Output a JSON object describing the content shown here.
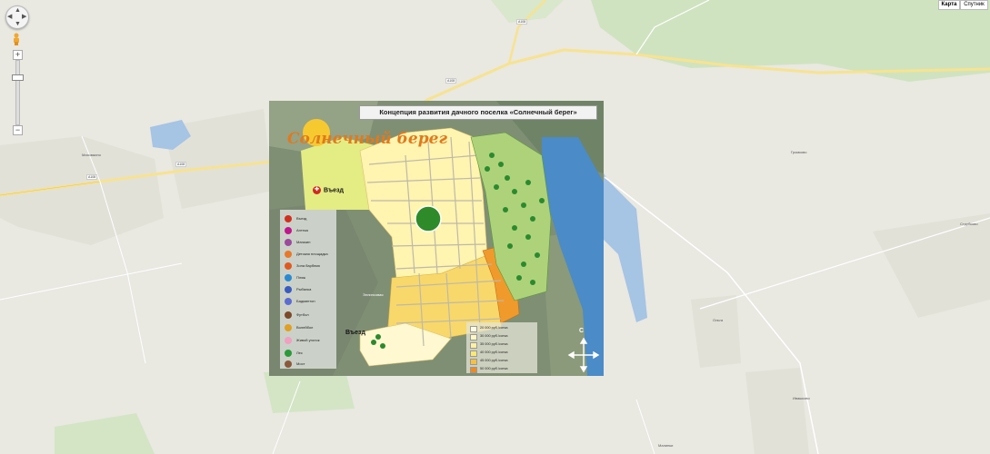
{
  "map_controls": {
    "pan_arrows": [
      "▲",
      "▼",
      "◀",
      "▶"
    ],
    "zoom_in": "+",
    "zoom_out": "−",
    "map_type_buttons": [
      {
        "label": "Карта",
        "active": true
      },
      {
        "label": "Спутник",
        "active": false
      }
    ]
  },
  "base_map": {
    "towns": [
      "Махомкино",
      "Ольга",
      "Струбково",
      "Малинки",
      "Ивашково",
      "Громково"
    ],
    "roads": [
      "А108",
      "А108",
      "А108",
      "А108"
    ]
  },
  "overlay": {
    "title": "Концепция развития дачного поселка «Солнечный берег»",
    "logo": "Солнечный берег",
    "entrances": [
      {
        "label": "Въезд"
      },
      {
        "label": "Въезд"
      }
    ],
    "street_label": "Эллипсовая",
    "compass_north": "С",
    "legend": [
      {
        "label": "Въезд",
        "icon": "entry-icon",
        "color": "#d0301e"
      },
      {
        "label": "Аптека",
        "icon": "pharmacy-icon",
        "color": "#c0188c"
      },
      {
        "label": "Магазин",
        "icon": "shop-icon",
        "color": "#9c4a9c"
      },
      {
        "label": "Детская площадка",
        "icon": "playground-icon",
        "color": "#e8782a"
      },
      {
        "label": "Зона барбекю",
        "icon": "barbecue-icon",
        "color": "#e05a20"
      },
      {
        "label": "Пляж",
        "icon": "beach-icon",
        "color": "#2a8ad0"
      },
      {
        "label": "Рыбалка",
        "icon": "fishing-icon",
        "color": "#3a5cc0"
      },
      {
        "label": "Бадминтон",
        "icon": "badminton-icon",
        "color": "#5a6cd0"
      },
      {
        "label": "Футбол",
        "icon": "football-icon",
        "color": "#7a4a2a"
      },
      {
        "label": "Волейбол",
        "icon": "volleyball-icon",
        "color": "#e0a020"
      },
      {
        "label": "Живой уголок",
        "icon": "petting-zoo-icon",
        "color": "#f0a0c0"
      },
      {
        "label": "Лес",
        "icon": "forest-icon",
        "color": "#2a9a3a"
      },
      {
        "label": "Мост",
        "icon": "bridge-icon",
        "color": "#8a5a3a"
      }
    ],
    "price_legend": [
      {
        "label": "20 000 руб./сотка",
        "color": "#fffbe0"
      },
      {
        "label": "30 000 руб./сотка",
        "color": "#fff6c0"
      },
      {
        "label": "35 000 руб./сотка",
        "color": "#fff0a0"
      },
      {
        "label": "40 000 руб./сотка",
        "color": "#fde870"
      },
      {
        "label": "45 000 руб./сотка",
        "color": "#f8c040"
      },
      {
        "label": "50 000 руб./сотка",
        "color": "#ee8a20"
      }
    ]
  },
  "colors": {
    "map_bg": "#e9e8e1",
    "road_major": "#f7e38f",
    "water": "#a6c4e4",
    "green_area": "#cfe3c0",
    "plot_light": "#fff4b0",
    "plot_orange": "#f19a2c"
  }
}
